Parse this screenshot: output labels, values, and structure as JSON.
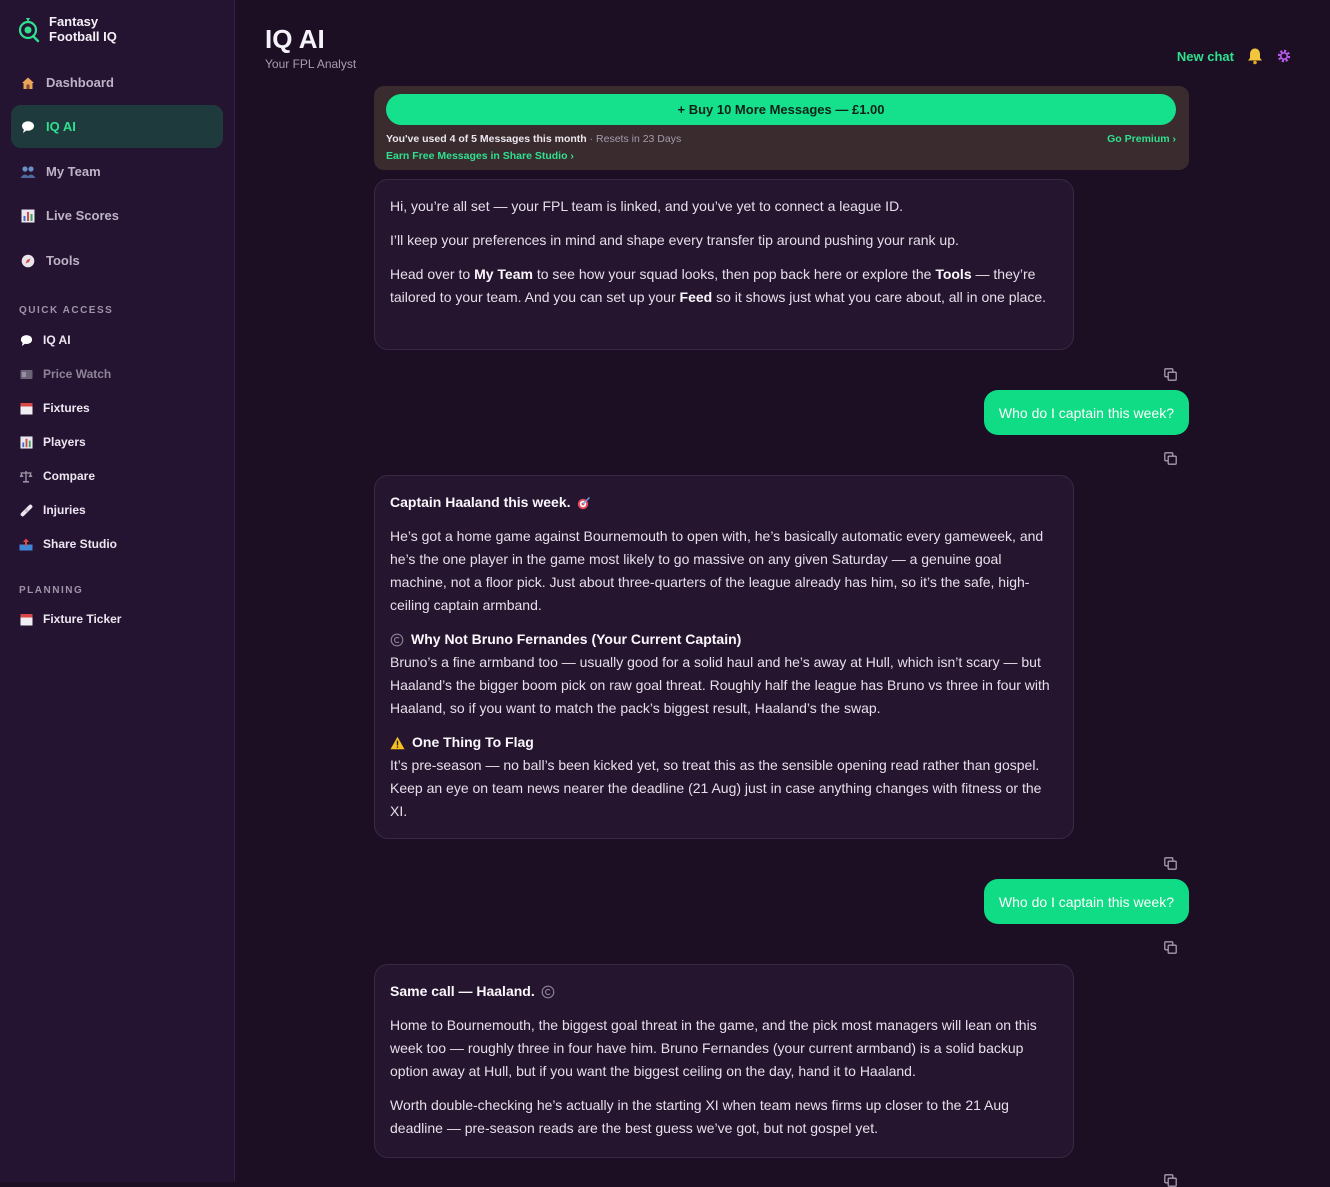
{
  "app": {
    "brand_line1": "Fantasy",
    "brand_line2": "Football IQ"
  },
  "sidebar": {
    "nav": [
      {
        "label": "Dashboard",
        "icon": "house-icon"
      },
      {
        "label": "IQ AI",
        "icon": "speech-bubble-icon",
        "active": true
      },
      {
        "label": "My Team",
        "icon": "people-icon"
      },
      {
        "label": "Live Scores",
        "icon": "bar-chart-icon"
      },
      {
        "label": "Tools",
        "icon": "compass-icon"
      }
    ],
    "quick_access_label": "QUICK ACCESS",
    "quick_access": [
      {
        "label": "IQ AI",
        "icon": "speech-bubble-icon"
      },
      {
        "label": "Price Watch",
        "icon": "price-tag-icon",
        "dim": true
      },
      {
        "label": "Fixtures",
        "icon": "calendar-icon"
      },
      {
        "label": "Players",
        "icon": "bar-chart-icon"
      },
      {
        "label": "Compare",
        "icon": "scales-icon"
      },
      {
        "label": "Injuries",
        "icon": "bandage-icon"
      },
      {
        "label": "Share Studio",
        "icon": "share-tray-icon"
      }
    ],
    "planning_label": "PLANNING",
    "planning": [
      {
        "label": "Fixture Ticker",
        "icon": "calendar-icon"
      }
    ]
  },
  "header": {
    "title": "IQ AI",
    "subtitle": "Your FPL Analyst",
    "new_chat": "New chat"
  },
  "upsell": {
    "buy_button": "+ Buy 10 More Messages — £1.00",
    "usage_text": "You've used 4 of 5 Messages this month",
    "resets_text": " · Resets in 23 Days",
    "earn_link": "Earn Free Messages in Share Studio ›",
    "premium_link": "Go Premium ›"
  },
  "messages": {
    "m1": {
      "p1": "Hi, you’re all set — your FPL team is linked, and you’ve yet to connect a league ID.",
      "p2": "I’ll keep your preferences in mind and shape every transfer tip around pushing your rank up.",
      "p3a": "Head over to ",
      "p3b": "My Team",
      "p3c": " to see how your squad looks, then pop back here or explore the ",
      "p3d": "Tools",
      "p3e": " — they’re tailored to your team. And you can set up your ",
      "p3f": "Feed",
      "p3g": " so it shows just what you care about, all in one place."
    },
    "u1": "Who do I captain this week?",
    "m2": {
      "title": "Captain Haaland this week.",
      "p1": "He’s got a home game against Bournemouth to open with, he’s basically automatic every gameweek, and he’s the one player in the game most likely to go massive on any given Saturday — a genuine goal machine, not a floor pick. Just about three-quarters of the league already has him, so it’s the safe, high-ceiling captain armband.",
      "h2": "Why Not Bruno Fernandes (Your Current Captain)",
      "p2": "Bruno’s a fine armband too — usually good for a solid haul and he’s away at Hull, which isn’t scary — but Haaland’s the bigger boom pick on raw goal threat. Roughly half the league has Bruno vs three in four with Haaland, so if you want to match the pack’s biggest result, Haaland’s the swap.",
      "h3": "One Thing To Flag",
      "p3": "It’s pre-season — no ball’s been kicked yet, so treat this as the sensible opening read rather than gospel. Keep an eye on team news nearer the deadline (21 Aug) just in case anything changes with fitness or the XI."
    },
    "u2": "Who do I captain this week?",
    "m3": {
      "title": "Same call — Haaland.",
      "p1": "Home to Bournemouth, the biggest goal threat in the game, and the pick most managers will lean on this week too — roughly three in four have him. Bruno Fernandes (your current armband) is a solid backup option away at Hull, but if you want the biggest ceiling on the day, hand it to Haaland.",
      "p2": "Worth double-checking he’s actually in the starting XI when team news firms up closer to the 21 Aug deadline — pre-season reads are the best guess we’ve got, but not gospel yet."
    }
  },
  "colors": {
    "accent": "#15e18c",
    "background": "#1c0f23",
    "sidebar": "#251431",
    "card": "#25152f"
  }
}
